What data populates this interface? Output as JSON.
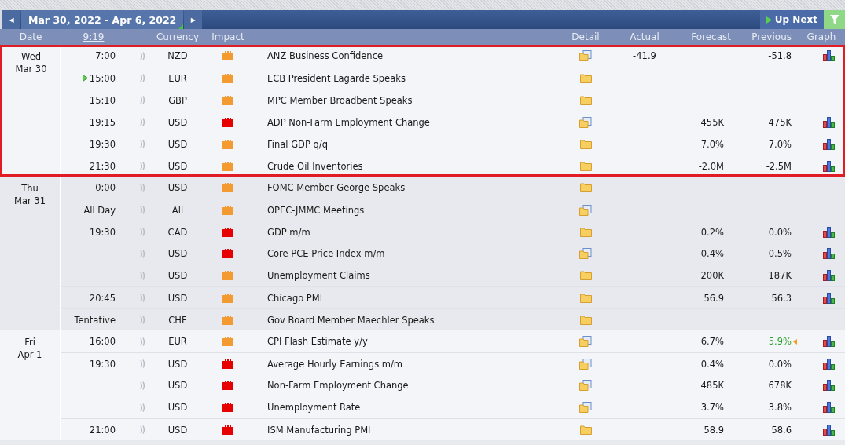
{
  "nav": {
    "prev": "◀",
    "range": "Mar 30, 2022 - Apr 6, 2022",
    "next": "▶",
    "up_next": "Up Next"
  },
  "columns": {
    "date": "Date",
    "time": "9:19",
    "currency": "Currency",
    "impact": "Impact",
    "detail": "Detail",
    "actual": "Actual",
    "forecast": "Forecast",
    "previous": "Previous",
    "graph": "Graph"
  },
  "days": [
    {
      "day": "Wed",
      "date": "Mar 30",
      "highlighted": true,
      "slots": [
        {
          "time": "7:00",
          "upcoming": false,
          "events": [
            {
              "currency": "NZD",
              "color": "#f39a30",
              "title": "ANZ Business Confidence",
              "kind": "report",
              "actual": "-41.9",
              "previous": "-51.8",
              "revised": false,
              "graph": true
            }
          ]
        },
        {
          "time": "15:00",
          "upcoming": true,
          "events": [
            {
              "currency": "EUR",
              "color": "#f39a30",
              "title": "ECB President Lagarde Speaks",
              "kind": "folder",
              "revised": false,
              "graph": false
            }
          ]
        },
        {
          "time": "15:10",
          "upcoming": false,
          "events": [
            {
              "currency": "GBP",
              "color": "#f39a30",
              "title": "MPC Member Broadbent Speaks",
              "kind": "folder",
              "revised": false,
              "graph": false
            }
          ]
        },
        {
          "time": "19:15",
          "upcoming": false,
          "events": [
            {
              "currency": "USD",
              "color": "#e60000",
              "title": "ADP Non-Farm Employment Change",
              "kind": "report",
              "forecast": "455K",
              "previous": "475K",
              "revised": false,
              "graph": true
            }
          ]
        },
        {
          "time": "19:30",
          "upcoming": false,
          "events": [
            {
              "currency": "USD",
              "color": "#f39a30",
              "title": "Final GDP q/q",
              "kind": "folder",
              "forecast": "7.0%",
              "previous": "7.0%",
              "revised": false,
              "graph": true
            }
          ]
        },
        {
          "time": "21:30",
          "upcoming": false,
          "events": [
            {
              "currency": "USD",
              "color": "#f39a30",
              "title": "Crude Oil Inventories",
              "kind": "folder",
              "forecast": "-2.0M",
              "previous": "-2.5M",
              "revised": false,
              "graph": true
            }
          ]
        }
      ]
    },
    {
      "day": "Thu",
      "date": "Mar 31",
      "highlighted": false,
      "slots": [
        {
          "time": "0:00",
          "upcoming": false,
          "events": [
            {
              "currency": "USD",
              "color": "#f39a30",
              "title": "FOMC Member George Speaks",
              "kind": "folder",
              "revised": false,
              "graph": false
            }
          ]
        },
        {
          "time": "All Day",
          "upcoming": false,
          "events": [
            {
              "currency": "All",
              "color": "#f39a30",
              "title": "OPEC-JMMC Meetings",
              "kind": "report",
              "revised": false,
              "graph": false
            }
          ]
        },
        {
          "time": "19:30",
          "upcoming": false,
          "events": [
            {
              "currency": "CAD",
              "color": "#e60000",
              "title": "GDP m/m",
              "kind": "folder",
              "forecast": "0.2%",
              "previous": "0.0%",
              "revised": false,
              "graph": true
            },
            {
              "currency": "USD",
              "color": "#e60000",
              "title": "Core PCE Price Index m/m",
              "kind": "report",
              "forecast": "0.4%",
              "previous": "0.5%",
              "revised": false,
              "graph": true
            },
            {
              "currency": "USD",
              "color": "#f39a30",
              "title": "Unemployment Claims",
              "kind": "folder",
              "forecast": "200K",
              "previous": "187K",
              "revised": false,
              "graph": true
            }
          ]
        },
        {
          "time": "20:45",
          "upcoming": false,
          "events": [
            {
              "currency": "USD",
              "color": "#f39a30",
              "title": "Chicago PMI",
              "kind": "folder",
              "forecast": "56.9",
              "previous": "56.3",
              "revised": false,
              "graph": true
            }
          ]
        },
        {
          "time": "Tentative",
          "upcoming": false,
          "events": [
            {
              "currency": "CHF",
              "color": "#f39a30",
              "title": "Gov Board Member Maechler Speaks",
              "kind": "folder",
              "revised": false,
              "graph": false
            }
          ]
        }
      ]
    },
    {
      "day": "Fri",
      "date": "Apr 1",
      "highlighted": false,
      "slots": [
        {
          "time": "16:00",
          "upcoming": false,
          "events": [
            {
              "currency": "EUR",
              "color": "#f39a30",
              "title": "CPI Flash Estimate y/y",
              "kind": "report",
              "forecast": "6.7%",
              "previous": "5.9%",
              "revised": true,
              "graph": true
            }
          ]
        },
        {
          "time": "19:30",
          "upcoming": false,
          "events": [
            {
              "currency": "USD",
              "color": "#e60000",
              "title": "Average Hourly Earnings m/m",
              "kind": "report",
              "forecast": "0.4%",
              "previous": "0.0%",
              "revised": false,
              "graph": true
            },
            {
              "currency": "USD",
              "color": "#e60000",
              "title": "Non-Farm Employment Change",
              "kind": "report",
              "forecast": "485K",
              "previous": "678K",
              "revised": false,
              "graph": true
            },
            {
              "currency": "USD",
              "color": "#e60000",
              "title": "Unemployment Rate",
              "kind": "report",
              "forecast": "3.7%",
              "previous": "3.8%",
              "revised": false,
              "graph": true
            }
          ]
        },
        {
          "time": "21:00",
          "upcoming": false,
          "events": [
            {
              "currency": "USD",
              "color": "#e60000",
              "title": "ISM Manufacturing PMI",
              "kind": "folder",
              "forecast": "58.9",
              "previous": "58.6",
              "revised": false,
              "graph": true
            }
          ]
        }
      ]
    }
  ]
}
